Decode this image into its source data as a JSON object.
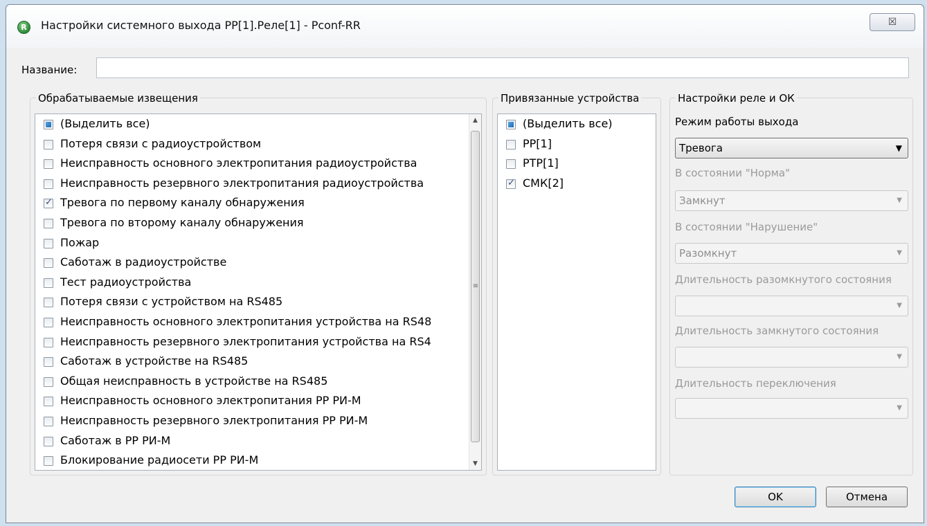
{
  "window": {
    "title": "Настройки системного выхода РР[1].Реле[1] - Pconf-RR",
    "app_icon_letter": "R",
    "close_symbol": "☒"
  },
  "name_field": {
    "label": "Название:",
    "value": ""
  },
  "events_group": {
    "legend": "Обрабатываемые извещения",
    "items": [
      {
        "label": "(Выделить все)",
        "state": "partial"
      },
      {
        "label": "Потеря связи с радиоустройством",
        "state": "unchecked"
      },
      {
        "label": "Неисправность основного электропитания радиоустройства",
        "state": "unchecked"
      },
      {
        "label": "Неисправность резервного электропитания радиоустройства",
        "state": "unchecked"
      },
      {
        "label": "Тревога по первому каналу обнаружения",
        "state": "checked"
      },
      {
        "label": "Тревога по второму каналу обнаружения",
        "state": "unchecked"
      },
      {
        "label": "Пожар",
        "state": "unchecked"
      },
      {
        "label": "Саботаж в радиоустройстве",
        "state": "unchecked"
      },
      {
        "label": "Тест радиоустройства",
        "state": "unchecked"
      },
      {
        "label": "Потеря связи с устройством на RS485",
        "state": "unchecked"
      },
      {
        "label": "Неисправность основного электропитания устройства на RS48",
        "state": "unchecked"
      },
      {
        "label": "Неисправность резервного электропитания устройства на RS4",
        "state": "unchecked"
      },
      {
        "label": "Саботаж в устройстве на RS485",
        "state": "unchecked"
      },
      {
        "label": "Общая неисправность в устройстве на RS485",
        "state": "unchecked"
      },
      {
        "label": "Неисправность основного электропитания РР РИ-М",
        "state": "unchecked"
      },
      {
        "label": "Неисправность резервного электропитания РР РИ-М",
        "state": "unchecked"
      },
      {
        "label": "Саботаж в РР РИ-М",
        "state": "unchecked"
      },
      {
        "label": "Блокирование радиосети РР РИ-М",
        "state": "unchecked"
      }
    ],
    "scrollbar": {
      "up_arrow": "▲",
      "down_arrow": "▼",
      "grip": "≡"
    }
  },
  "devices_group": {
    "legend": "Привязанные устройства",
    "items": [
      {
        "label": "(Выделить все)",
        "state": "partial"
      },
      {
        "label": "РР[1]",
        "state": "unchecked"
      },
      {
        "label": "РТР[1]",
        "state": "unchecked"
      },
      {
        "label": "СМК[2]",
        "state": "checked"
      }
    ]
  },
  "relay_group": {
    "legend": "Настройки реле и ОК",
    "mode": {
      "label": "Режим работы выхода",
      "value": "Тревога",
      "enabled": true
    },
    "norm_state": {
      "label": "В состоянии \"Норма\"",
      "value": "Замкнут",
      "enabled": false
    },
    "violation_state": {
      "label": "В состоянии \"Нарушение\"",
      "value": "Разомкнут",
      "enabled": false
    },
    "open_duration": {
      "label": "Длительность разомкнутого состояния",
      "value": "",
      "enabled": false
    },
    "closed_duration": {
      "label": "Длительность замкнутого состояния",
      "value": "",
      "enabled": false
    },
    "switch_duration": {
      "label": "Длительность переключения",
      "value": "",
      "enabled": false
    },
    "dropdown_arrow": "▼"
  },
  "buttons": {
    "ok": "OK",
    "cancel": "Отмена"
  }
}
